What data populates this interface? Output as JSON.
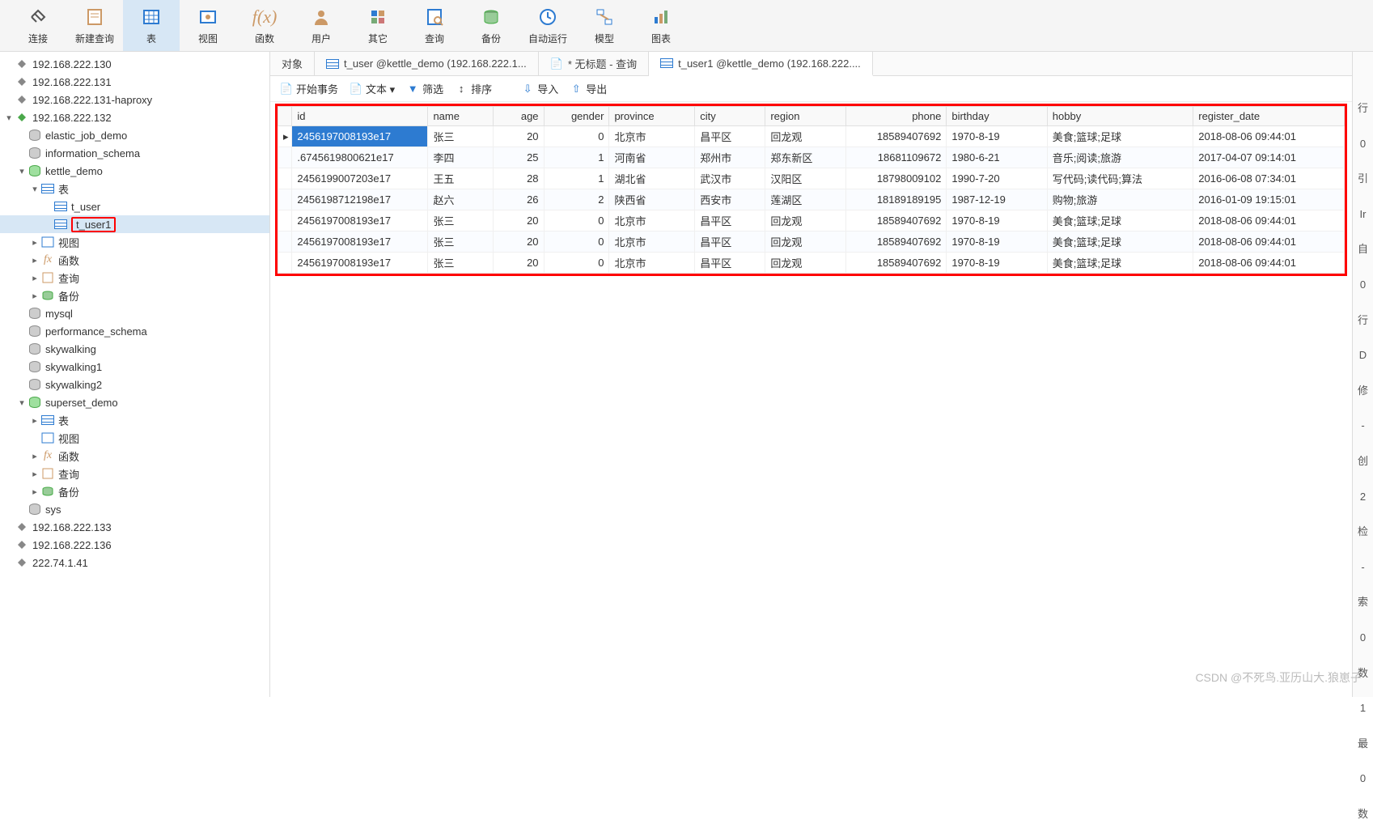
{
  "toolbar": [
    {
      "label": "连接",
      "icon": "plug"
    },
    {
      "label": "新建查询",
      "icon": "sheet"
    },
    {
      "label": "表",
      "icon": "table",
      "active": true
    },
    {
      "label": "视图",
      "icon": "view"
    },
    {
      "label": "函数",
      "icon": "fx"
    },
    {
      "label": "用户",
      "icon": "user"
    },
    {
      "label": "其它",
      "icon": "other"
    },
    {
      "label": "查询",
      "icon": "query"
    },
    {
      "label": "备份",
      "icon": "backup"
    },
    {
      "label": "自动运行",
      "icon": "auto"
    },
    {
      "label": "模型",
      "icon": "model"
    },
    {
      "label": "图表",
      "icon": "chart"
    }
  ],
  "tree": [
    {
      "lvl": 0,
      "exp": "",
      "icon": "conn",
      "label": "192.168.222.130"
    },
    {
      "lvl": 0,
      "exp": "",
      "icon": "conn",
      "label": "192.168.222.131"
    },
    {
      "lvl": 0,
      "exp": "",
      "icon": "conn",
      "label": "192.168.222.131-haproxy"
    },
    {
      "lvl": 0,
      "exp": "v",
      "icon": "conn-open",
      "label": "192.168.222.132"
    },
    {
      "lvl": 1,
      "exp": "",
      "icon": "db",
      "label": "elastic_job_demo"
    },
    {
      "lvl": 1,
      "exp": "",
      "icon": "db",
      "label": "information_schema"
    },
    {
      "lvl": 1,
      "exp": "v",
      "icon": "db-open",
      "label": "kettle_demo"
    },
    {
      "lvl": 2,
      "exp": "v",
      "icon": "table",
      "label": "表"
    },
    {
      "lvl": 3,
      "exp": "",
      "icon": "tbl",
      "label": "t_user"
    },
    {
      "lvl": 3,
      "exp": "",
      "icon": "tbl",
      "label": "t_user1",
      "sel": true,
      "red": true
    },
    {
      "lvl": 2,
      "exp": ">",
      "icon": "view",
      "label": "视图"
    },
    {
      "lvl": 2,
      "exp": ">",
      "icon": "fx",
      "label": "函数"
    },
    {
      "lvl": 2,
      "exp": ">",
      "icon": "query",
      "label": "查询"
    },
    {
      "lvl": 2,
      "exp": ">",
      "icon": "backup",
      "label": "备份"
    },
    {
      "lvl": 1,
      "exp": "",
      "icon": "db",
      "label": "mysql"
    },
    {
      "lvl": 1,
      "exp": "",
      "icon": "db",
      "label": "performance_schema"
    },
    {
      "lvl": 1,
      "exp": "",
      "icon": "db",
      "label": "skywalking"
    },
    {
      "lvl": 1,
      "exp": "",
      "icon": "db",
      "label": "skywalking1"
    },
    {
      "lvl": 1,
      "exp": "",
      "icon": "db",
      "label": "skywalking2"
    },
    {
      "lvl": 1,
      "exp": "v",
      "icon": "db-open",
      "label": "superset_demo"
    },
    {
      "lvl": 2,
      "exp": ">",
      "icon": "table",
      "label": "表"
    },
    {
      "lvl": 2,
      "exp": "",
      "icon": "view",
      "label": "视图"
    },
    {
      "lvl": 2,
      "exp": ">",
      "icon": "fx",
      "label": "函数"
    },
    {
      "lvl": 2,
      "exp": ">",
      "icon": "query",
      "label": "查询"
    },
    {
      "lvl": 2,
      "exp": ">",
      "icon": "backup",
      "label": "备份"
    },
    {
      "lvl": 1,
      "exp": "",
      "icon": "db",
      "label": "sys"
    },
    {
      "lvl": 0,
      "exp": "",
      "icon": "conn",
      "label": "192.168.222.133"
    },
    {
      "lvl": 0,
      "exp": "",
      "icon": "conn",
      "label": "192.168.222.136"
    },
    {
      "lvl": 0,
      "exp": "",
      "icon": "conn",
      "label": "222.74.1.41"
    }
  ],
  "tabs": [
    {
      "label": "对象",
      "icon": "none"
    },
    {
      "label": "t_user @kettle_demo (192.168.222.1...",
      "icon": "grid"
    },
    {
      "label": "* 无标题 - 查询",
      "icon": "sheet"
    },
    {
      "label": "t_user1 @kettle_demo (192.168.222....",
      "icon": "grid",
      "active": true
    }
  ],
  "subbar": {
    "begin": "开始事务",
    "text": "文本 ▾",
    "filter": "筛选",
    "sort": "排序",
    "import": "导入",
    "export": "导出"
  },
  "grid": {
    "columns": [
      "id",
      "name",
      "age",
      "gender",
      "province",
      "city",
      "region",
      "phone",
      "birthday",
      "hobby",
      "register_date"
    ],
    "widths": [
      135,
      65,
      50,
      65,
      85,
      70,
      80,
      100,
      100,
      145,
      150
    ],
    "align": [
      "l",
      "l",
      "r",
      "r",
      "l",
      "l",
      "l",
      "r",
      "l",
      "l",
      "l"
    ],
    "rows": [
      {
        "sel": true,
        "ptr": true,
        "cells": [
          "2456197008193e17",
          "张三",
          "20",
          "0",
          "北京市",
          "昌平区",
          "回龙观",
          "18589407692",
          "1970-8-19",
          "美食;篮球;足球",
          "2018-08-06 09:44:01"
        ]
      },
      {
        "cells": [
          ".6745619800621e17",
          "李四",
          "25",
          "1",
          "河南省",
          "郑州市",
          "郑东新区",
          "18681109672",
          "1980-6-21",
          "音乐;阅读;旅游",
          "2017-04-07 09:14:01"
        ]
      },
      {
        "cells": [
          "2456199007203e17",
          "王五",
          "28",
          "1",
          "湖北省",
          "武汉市",
          "汉阳区",
          "18798009102",
          "1990-7-20",
          "写代码;读代码;算法",
          "2016-06-08 07:34:01"
        ]
      },
      {
        "cells": [
          "2456198712198e17",
          "赵六",
          "26",
          "2",
          "陕西省",
          "西安市",
          "莲湖区",
          "18189189195",
          "1987-12-19",
          "购物;旅游",
          "2016-01-09 19:15:01"
        ]
      },
      {
        "cells": [
          "2456197008193e17",
          "张三",
          "20",
          "0",
          "北京市",
          "昌平区",
          "回龙观",
          "18589407692",
          "1970-8-19",
          "美食;篮球;足球",
          "2018-08-06 09:44:01"
        ]
      },
      {
        "cells": [
          "2456197008193e17",
          "张三",
          "20",
          "0",
          "北京市",
          "昌平区",
          "回龙观",
          "18589407692",
          "1970-8-19",
          "美食;篮球;足球",
          "2018-08-06 09:44:01"
        ]
      },
      {
        "cells": [
          "2456197008193e17",
          "张三",
          "20",
          "0",
          "北京市",
          "昌平区",
          "回龙观",
          "18589407692",
          "1970-8-19",
          "美食;篮球;足球",
          "2018-08-06 09:44:01"
        ]
      }
    ]
  },
  "right_strip": [
    "行",
    "0",
    "引",
    "Ir",
    "自",
    "0",
    "行",
    "D",
    "修",
    "-",
    "创",
    "2",
    "检",
    "-",
    "索",
    "0",
    "数",
    "1",
    "最",
    "0",
    "数"
  ],
  "watermark": "CSDN @不死鸟.亚历山大.狼崽子"
}
